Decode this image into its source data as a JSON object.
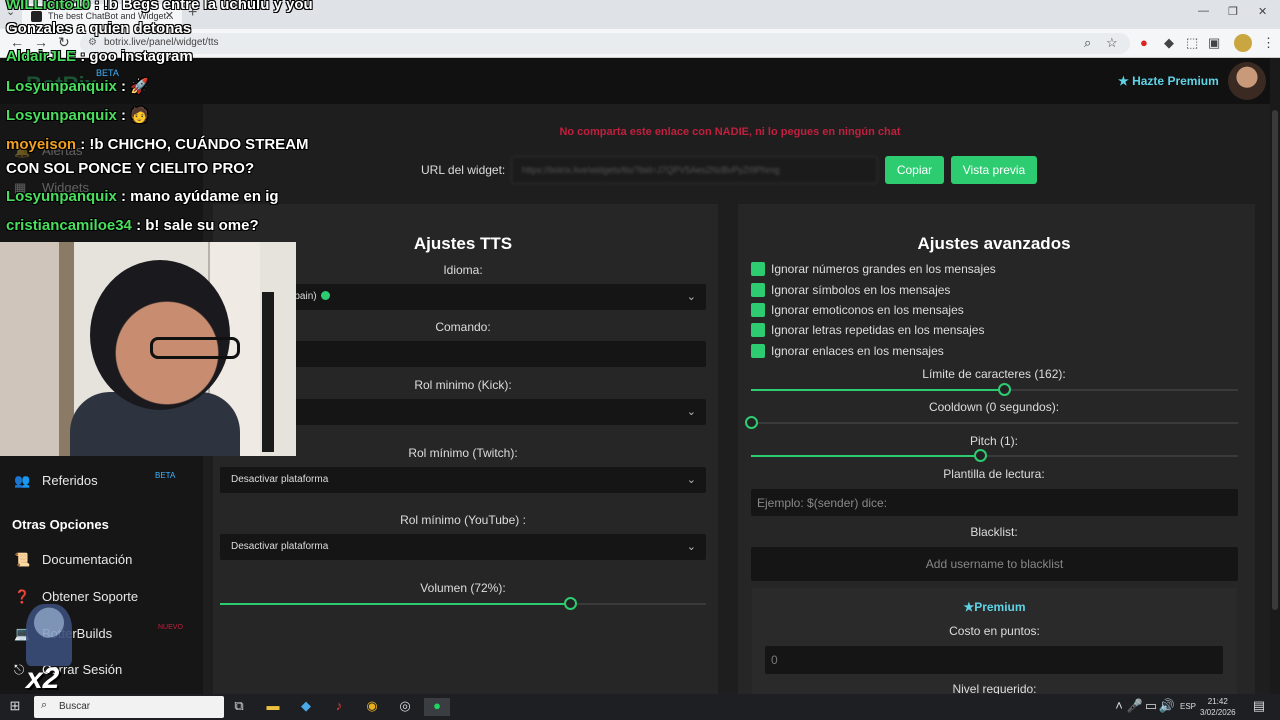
{
  "browser": {
    "tab_title": "The best ChatBot and Widget...",
    "url": "botrix.live/panel/widget/tts"
  },
  "header": {
    "logo": "BotRix",
    "beta": "BETA",
    "premium_link": "Hazte Premium"
  },
  "warning": "No comparta este enlace con NADIE, ni lo pegues en ningún chat",
  "widget_url": {
    "label": "URL del widget:",
    "value": "https://botrix.live/widgets/tts/?bid=J7QPV5Aes2NzBvPyZt9Phmg",
    "copy_button": "Copiar",
    "preview_button": "Vista previa"
  },
  "tts_settings": {
    "title": "Ajustes TTS",
    "language_label": "Idioma:",
    "language_value": "a - Spanish (Spain)",
    "command_label": "Comando:",
    "command_value": "",
    "kick_role_label": "Rol minimo (Kick):",
    "kick_role_value": "",
    "twitch_role_label": "Rol mínimo (Twitch):",
    "twitch_role_value": "Desactivar plataforma",
    "youtube_role_label": "Rol mínimo (YouTube) :",
    "youtube_role_value": "Desactivar plataforma",
    "volume_label": "Volumen (72%):",
    "volume_percent": 72
  },
  "advanced": {
    "title": "Ajustes avanzados",
    "checkboxes": [
      "Ignorar números grandes en los mensajes",
      "Ignorar símbolos en los mensajes",
      "Ignorar emoticonos en los mensajes",
      "Ignorar letras repetidas en los mensajes",
      "Ignorar enlaces en los mensajes"
    ],
    "char_limit_label": "Límite de caracteres (162):",
    "char_limit_fraction": 0.52,
    "cooldown_label": "Cooldown (0 segundos):",
    "cooldown_fraction": 0,
    "pitch_label": "Pitch (1):",
    "pitch_fraction": 0.47,
    "template_label": "Plantilla de lectura:",
    "template_placeholder": "Ejemplo: $(sender) dice:",
    "blacklist_label": "Blacklist:",
    "blacklist_placeholder": "Add username to blacklist",
    "premium_title": "Premium",
    "cost_label": "Costo en puntos:",
    "cost_value": "0",
    "level_label": "Nivel requerido:"
  },
  "sidebar": {
    "items": [
      {
        "label": "Alertas"
      },
      {
        "label": "Widgets"
      },
      {
        "label": "Referidos",
        "badge": "BETA"
      }
    ],
    "other_heading": "Otras Opciones",
    "other_items": [
      {
        "label": "Documentación"
      },
      {
        "label": "Obtener Soporte"
      },
      {
        "label": "BotterBuilds",
        "badge": "NUEVO"
      },
      {
        "label": "Cerrar Sesión"
      }
    ]
  },
  "chat": [
    {
      "user": "WILLicito10",
      "text": " : !b Begs entre la uchulu y you"
    },
    {
      "user": "",
      "text": "Gonzales a quien detonas"
    },
    {
      "user": "AldairJLE",
      "text": " : goo instagram"
    },
    {
      "user": "Losyunpanquix",
      "text": " : 🚀"
    },
    {
      "user": "Losyunpanquix",
      "text": " : 🧑"
    },
    {
      "user": "moyeison",
      "text": " : !b CHICHO, CUÁNDO STREAM"
    },
    {
      "user": "",
      "text": "CON SOL PONCE Y CIELITO PRO?"
    },
    {
      "user": "Losyunpanquix",
      "text": " : mano ayúdame en ig"
    },
    {
      "user": "cristiancamiloe34",
      "text": " : b! sale su ome?"
    }
  ],
  "overlay_badge": "x2",
  "taskbar": {
    "search_placeholder": "Buscar",
    "lang": "ESP",
    "time": "21:42",
    "date": "3/02/2026"
  },
  "colors": {
    "accent": "#2ecc71",
    "warning": "#c0203e",
    "premium": "#5fd3e6"
  }
}
